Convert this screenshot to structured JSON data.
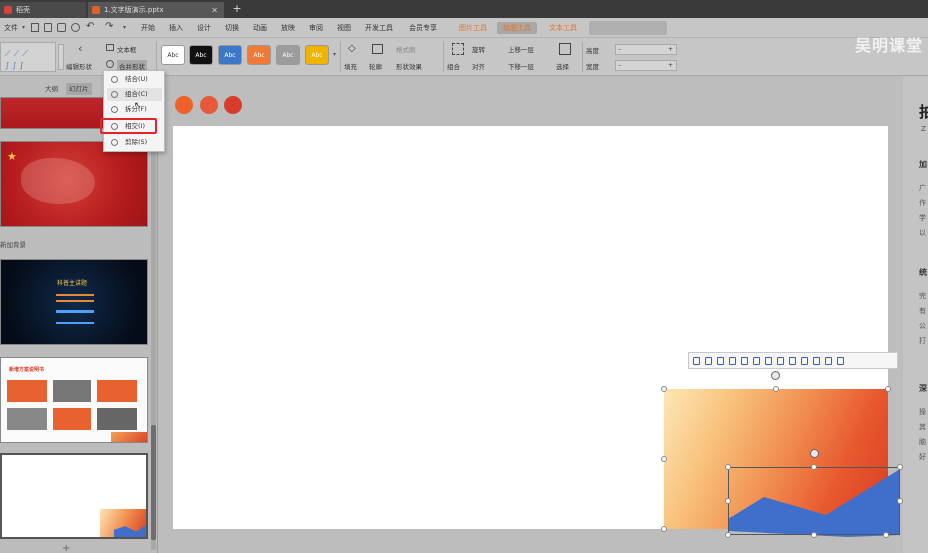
{
  "titlebar": {
    "tabs": [
      {
        "label": "稻壳",
        "icon": "wps-icon"
      },
      {
        "label": "1.文字版演示.pptx",
        "icon": "ppt-icon"
      }
    ],
    "add_tab": "+"
  },
  "menubar": {
    "file": "文件",
    "items": [
      "开始",
      "插入",
      "设计",
      "切换",
      "动画",
      "放映",
      "审阅",
      "视图",
      "开发工具",
      "会员专享"
    ],
    "context_tabs": [
      "图片工具",
      "绘图工具",
      "文本工具"
    ]
  },
  "ribbon": {
    "textbox": "文本框",
    "edit_shape": "编辑形状",
    "merge_shape": "合并形状",
    "style_swatches": [
      {
        "label": "Abc",
        "bg": "#ffffff",
        "fg": "#333333"
      },
      {
        "label": "Abc",
        "bg": "#111111",
        "fg": "#ffffff"
      },
      {
        "label": "Abc",
        "bg": "#3d78c8",
        "fg": "#ffffff"
      },
      {
        "label": "Abc",
        "bg": "#ee7a35",
        "fg": "#ffffff"
      },
      {
        "label": "Abc",
        "bg": "#9c9c9c",
        "fg": "#ffffff"
      },
      {
        "label": "Abc",
        "bg": "#f0b400",
        "fg": "#ffffff"
      }
    ],
    "fill": "填充",
    "outline": "轮廓",
    "format_painter": "格式刷",
    "shape_effect": "形状效果",
    "group": "组合",
    "rotate": "旋转",
    "align": "对齐",
    "bring_forward": "上移一层",
    "send_backward": "下移一层",
    "select": "选择",
    "height_label": "高度",
    "width_label": "宽度",
    "brand": "吴明课堂"
  },
  "merge_menu": {
    "items": [
      "结合(U)",
      "组合(C)",
      "拆分(F)",
      "相交(I)",
      "剪除(S)"
    ],
    "highlighted": 3
  },
  "leftpanel": {
    "tabs": [
      "大纲",
      "幻灯片"
    ],
    "section_label": "新加背景",
    "thumb3_title": "科普主讲题",
    "thumb4_title": "新增方案说明书"
  },
  "accent_dots": [
    "#f0602b",
    "#e8593a",
    "#d83d2b"
  ],
  "colors": {
    "highlight": "#e0262b",
    "polygon": "#3f6fcb"
  },
  "rightpane": {
    "title": "拍",
    "sub": "Z",
    "sections": [
      {
        "heading": "加",
        "lines": [
          "广",
          "作",
          "学",
          "以"
        ]
      },
      {
        "heading": "统",
        "lines": [
          "完",
          "有",
          "公",
          "打"
        ]
      },
      {
        "heading": "深",
        "lines": [
          "操",
          "其",
          "脑",
          "好"
        ]
      }
    ]
  }
}
